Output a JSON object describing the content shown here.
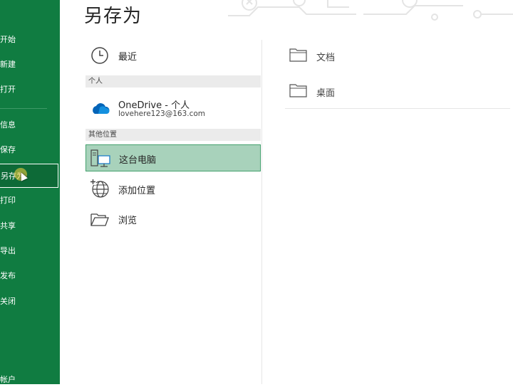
{
  "page": {
    "title": "另存为"
  },
  "nav": {
    "items": [
      {
        "label": "开始",
        "selected": false
      },
      {
        "label": "新建",
        "selected": false
      },
      {
        "label": "打开",
        "selected": false
      },
      {
        "label": "信息",
        "selected": false
      },
      {
        "label": "保存",
        "selected": false
      },
      {
        "label": "另存为",
        "selected": true
      },
      {
        "label": "打印",
        "selected": false
      },
      {
        "label": "共享",
        "selected": false
      },
      {
        "label": "导出",
        "selected": false
      },
      {
        "label": "发布",
        "selected": false
      },
      {
        "label": "关闭",
        "selected": false
      },
      {
        "label": "帐户",
        "selected": false
      }
    ]
  },
  "locations": {
    "recent": {
      "label": "最近",
      "icon": "clock-icon"
    },
    "personal_header": "个人",
    "onedrive": {
      "label": "OneDrive - 个人",
      "account": "lovehere123@163.com",
      "icon": "cloud-icon"
    },
    "other_header": "其他位置",
    "this_pc": {
      "label": "这台电脑",
      "icon": "computer-icon",
      "selected": true
    },
    "add_place": {
      "label": "添加位置",
      "icon": "globe-add-icon"
    },
    "browse": {
      "label": "浏览",
      "icon": "open-folder-icon"
    }
  },
  "folders": [
    {
      "label": "文档",
      "icon": "folder-icon"
    },
    {
      "label": "桌面",
      "icon": "folder-icon"
    }
  ],
  "colors": {
    "nav_bg": "#107c41",
    "selected_bg": "#a8d2bb",
    "selected_border": "#43a06d",
    "accent_blue": "#0364b8"
  }
}
